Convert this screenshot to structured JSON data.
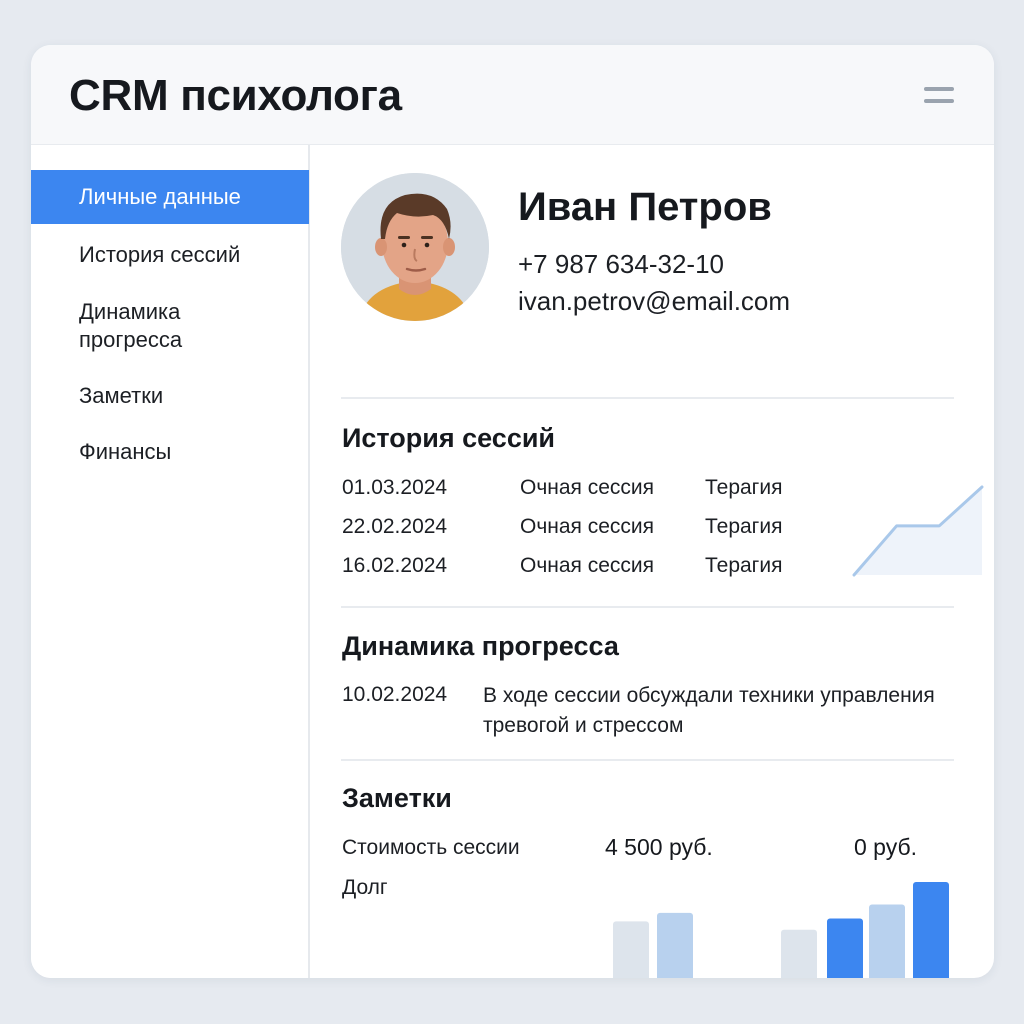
{
  "app": {
    "title": "CRM психолога"
  },
  "sidebar": {
    "items": [
      {
        "label": "Личные данные",
        "active": true
      },
      {
        "label": "История сессий",
        "active": false
      },
      {
        "label": "Динамика\nпрогресса",
        "active": false
      },
      {
        "label": "Заметки",
        "active": false
      },
      {
        "label": "Финансы",
        "active": false
      }
    ]
  },
  "client": {
    "name": "Иван Петров",
    "phone": "+7 987 634-32-10",
    "email": "ivan.petrov@email.com"
  },
  "sessions": {
    "title": "История сессий",
    "rows": [
      {
        "date": "01.03.2024",
        "type": "Очная сессия",
        "kind": "Терагия"
      },
      {
        "date": "22.02.2024",
        "type": "Очная сессия",
        "kind": "Терагия"
      },
      {
        "date": "16.02.2024",
        "type": "Очная сессия",
        "kind": "Терагия"
      }
    ]
  },
  "progress": {
    "title": "Динамика прогресса",
    "date": "10.02.2024",
    "text": "В ходе сессии обсуждали техники управления тревогой и стрессом"
  },
  "notes": {
    "title": "Заметки",
    "cost_label": "Стоимость сессии",
    "cost_value": "4 500 руб.",
    "debt_label": "Долг",
    "debt_value": "0 руб."
  },
  "colors": {
    "accent": "#3c86f0",
    "bar_light": "#dde4ec",
    "bar_mid": "#b8d1ee",
    "bar_dark": "#3c86f0",
    "line": "#a9c8ea",
    "area": "#eef3fa"
  },
  "chart_data": [
    {
      "type": "line",
      "points": [
        0,
        1.9,
        1.9,
        3.4
      ],
      "ylim": [
        0,
        3.4
      ]
    },
    {
      "type": "bar",
      "values": [
        2.3,
        2.6,
        0,
        0,
        2.0,
        2.4,
        2.9,
        3.7
      ],
      "colors": [
        "light",
        "mid",
        "none",
        "none",
        "light",
        "dark",
        "mid",
        "dark"
      ],
      "ylim": [
        0,
        3.7
      ]
    }
  ]
}
